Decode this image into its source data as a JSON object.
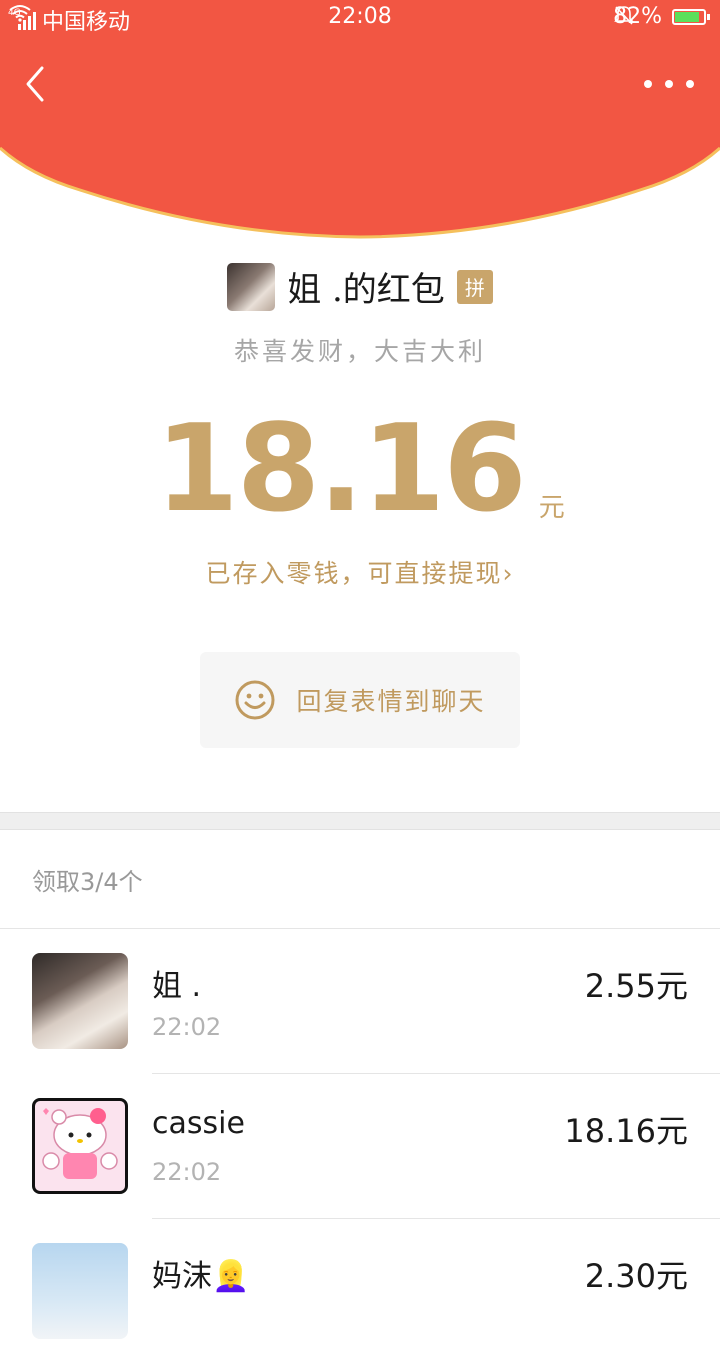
{
  "status_bar": {
    "network": "4G",
    "carrier": "中国移动",
    "time": "22:08",
    "battery": "82%"
  },
  "colors": {
    "header_red": "#f25643",
    "gold": "#c9a56b",
    "arc_border": "#f5c05c"
  },
  "packet": {
    "sender_name": "姐 .的红包",
    "badge": "拼",
    "greeting": "恭喜发财，大吉大利",
    "amount": "18.16",
    "amount_unit": "元",
    "saved_link": "已存入零钱，可直接提现",
    "reply_button": "回复表情到聊天"
  },
  "list": {
    "summary": "领取3/4个",
    "rows": [
      {
        "name": "姐 .",
        "time": "22:02",
        "amount": "2.55元"
      },
      {
        "name": "cassie",
        "time": "22:02",
        "amount": "18.16元"
      },
      {
        "name": "妈沫👱‍♀️",
        "time": "",
        "amount": "2.30元"
      }
    ]
  }
}
